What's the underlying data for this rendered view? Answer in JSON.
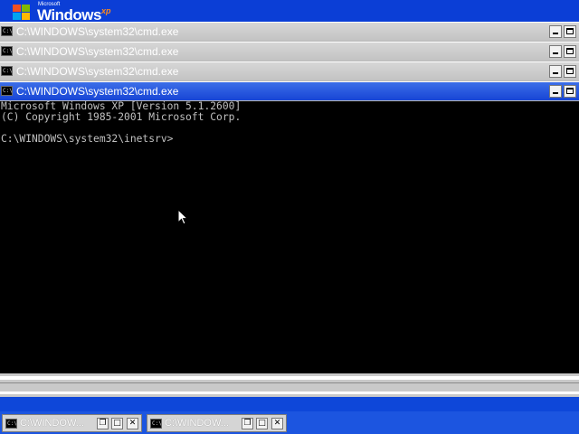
{
  "desktop": {
    "logo_small": "Microsoft",
    "logo_word": "Windows",
    "logo_xp": "xp",
    "colors": {
      "desktop_blue": "#0b3ed6",
      "active_title": "#1745d5",
      "inactive_title": "#c3c3c3"
    }
  },
  "windows": [
    {
      "title": "C:\\WINDOWS\\system32\\cmd.exe",
      "state": "inactive"
    },
    {
      "title": "C:\\WINDOWS\\system32\\cmd.exe",
      "state": "inactive"
    },
    {
      "title": "C:\\WINDOWS\\system32\\cmd.exe",
      "state": "inactive"
    },
    {
      "title": "C:\\WINDOWS\\system32\\cmd.exe",
      "state": "active"
    }
  ],
  "window_icon": "cmd-icon",
  "window_icon_text": "C:\\",
  "console": {
    "lines": [
      "Microsoft Windows XP [Version 5.1.2600]",
      "(C) Copyright 1985-2001 Microsoft Corp.",
      "",
      "C:\\WINDOWS\\system32\\inetsrv>"
    ]
  },
  "taskbar": {
    "items": [
      {
        "label": "C:\\WINDOW..."
      },
      {
        "label": "C:\\WINDOW..."
      }
    ]
  }
}
